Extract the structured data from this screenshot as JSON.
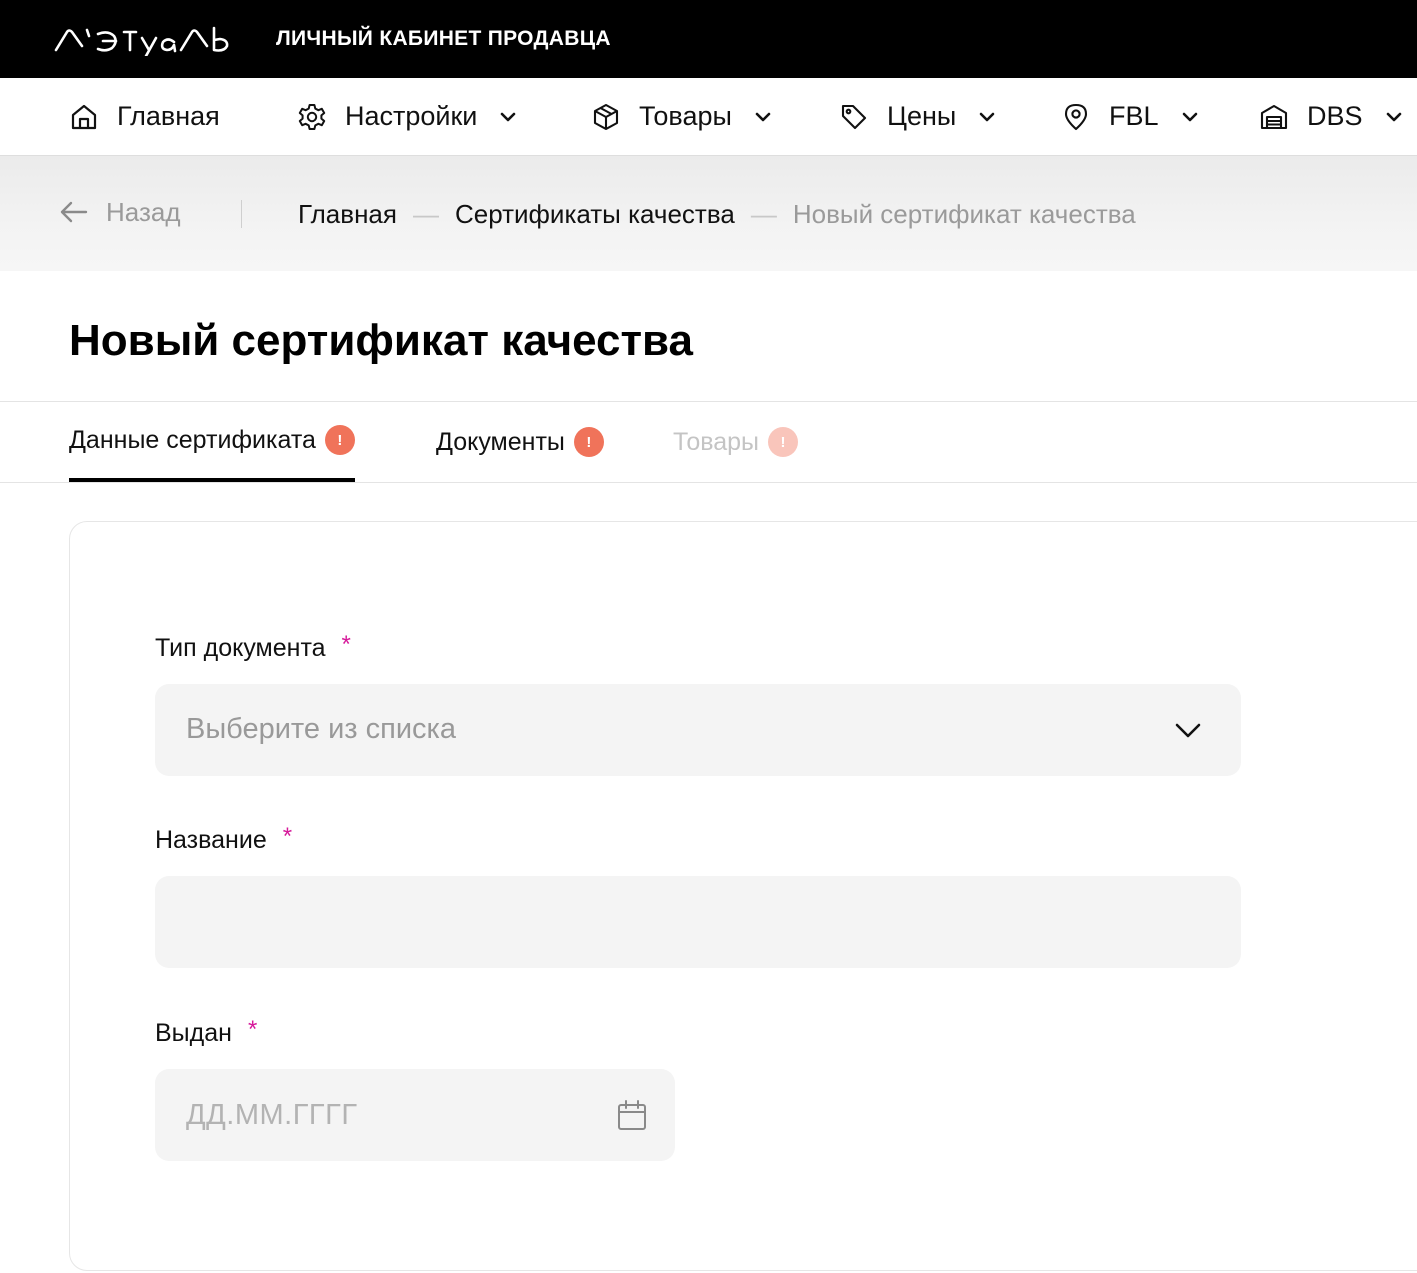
{
  "brand": {
    "logo_text": "Л'Этуаль",
    "cabinet_title": "ЛИЧНЫЙ КАБИНЕТ ПРОДАВЦА"
  },
  "nav": {
    "items": [
      {
        "label": "Главная",
        "icon": "home-icon",
        "has_dropdown": false
      },
      {
        "label": "Настройки",
        "icon": "gear-icon",
        "has_dropdown": true
      },
      {
        "label": "Товары",
        "icon": "box-icon",
        "has_dropdown": true
      },
      {
        "label": "Цены",
        "icon": "tag-icon",
        "has_dropdown": true
      },
      {
        "label": "FBL",
        "icon": "map-pin-icon",
        "has_dropdown": true
      },
      {
        "label": "DBS",
        "icon": "warehouse-icon",
        "has_dropdown": true
      }
    ]
  },
  "breadcrumbs": {
    "back_label": "Назад",
    "items": [
      "Главная",
      "Сертификаты качества"
    ],
    "current": "Новый сертификат качества",
    "separator": "—"
  },
  "page": {
    "title": "Новый сертификат качества"
  },
  "tabs": [
    {
      "label": "Данные сертификата",
      "badge": "!",
      "state": "active"
    },
    {
      "label": "Документы",
      "badge": "!",
      "state": "normal"
    },
    {
      "label": "Товары",
      "badge": "!",
      "state": "disabled"
    }
  ],
  "form": {
    "required_mark": "*",
    "doc_type": {
      "label": "Тип документа",
      "placeholder": "Выберите из списка",
      "value": ""
    },
    "name": {
      "label": "Название",
      "value": ""
    },
    "issued": {
      "label": "Выдан",
      "placeholder": "ДД.ММ.ГГГГ",
      "value": ""
    }
  },
  "colors": {
    "topbar": "#000000",
    "badge_active": "#f0735a",
    "badge_disabled": "#f9c5bb",
    "required": "#d6199a",
    "field_bg": "#f4f4f4"
  }
}
